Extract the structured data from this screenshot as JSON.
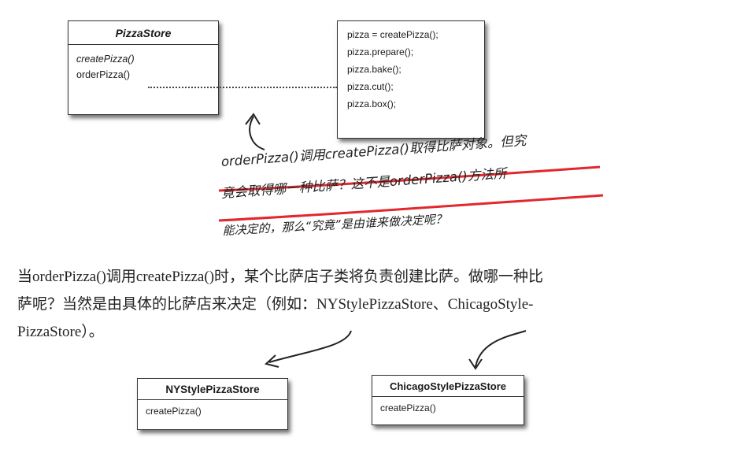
{
  "pizza_store": {
    "title": "PizzaStore",
    "methods": [
      "createPizza()",
      "orderPizza()"
    ]
  },
  "code_box": {
    "lines": [
      "pizza = createPizza();",
      "pizza.prepare();",
      "pizza.bake();",
      "pizza.cut();",
      "pizza.box();"
    ]
  },
  "annotation": {
    "line1": "orderPizza()调用createPizza()取得比萨对象。但究",
    "line2": "竟会取得哪一种比萨？这不是orderPizza()方法所",
    "line3": "能决定的，那么“究竟”是由谁来做决定呢？"
  },
  "paragraph": {
    "line1": "当orderPizza()调用createPizza()时，某个比萨店子类将负责创建比萨。做哪一种比",
    "line2": "萨呢？当然是由具体的比萨店来决定（例如：NYStylePizzaStore、ChicagoStyle-",
    "line3": "PizzaStore）。"
  },
  "ny_store": {
    "title": "NYStylePizzaStore",
    "method": "createPizza()"
  },
  "chicago_store": {
    "title": "ChicagoStylePizzaStore",
    "method": "createPizza()"
  },
  "colors": {
    "underline": "#e0282e",
    "ink": "#222222"
  }
}
